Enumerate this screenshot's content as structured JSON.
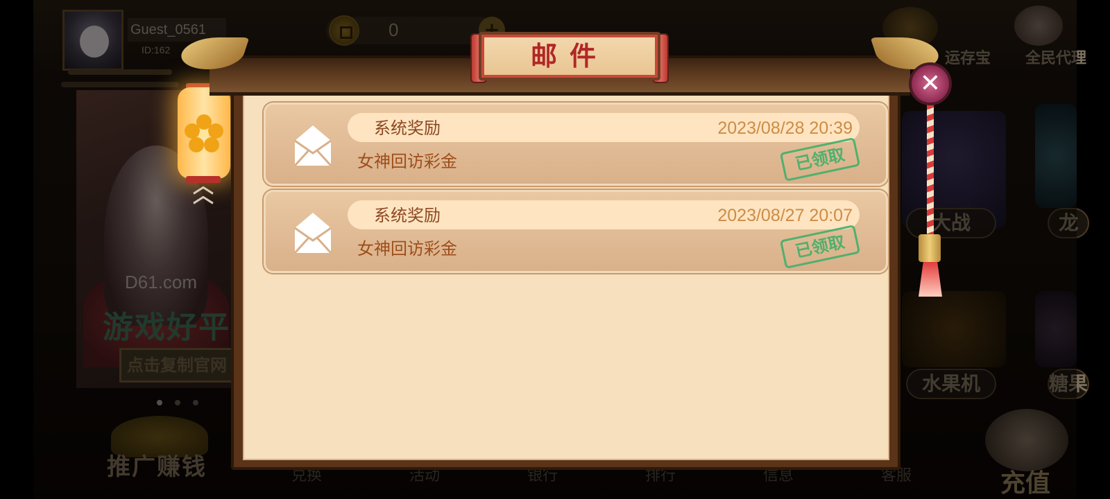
{
  "background": {
    "player": {
      "name": "Guest_0561",
      "id": "ID:162"
    },
    "coins": {
      "amount": "0"
    },
    "poster": {
      "site": "D61.com",
      "slogan": "游戏好平",
      "copy_button": "点击复制官网"
    },
    "promo_label": "推广赚钱",
    "bottom_nav": [
      "兑换",
      "活动",
      "银行",
      "排行",
      "信息",
      "客服"
    ],
    "top_right": [
      "运存宝",
      "全民代理"
    ],
    "right_games": [
      "大战",
      "龙",
      "水果机",
      "糖果"
    ],
    "recharge_label": "充值"
  },
  "dialog": {
    "title": "邮件",
    "close_symbol": "✕",
    "mails": [
      {
        "sender": "系统奖励",
        "time": "2023/08/28 20:39",
        "subject": "女神回访彩金",
        "status": "已领取"
      },
      {
        "sender": "系统奖励",
        "time": "2023/08/27 20:07",
        "subject": "女神回访彩金",
        "status": "已领取"
      }
    ]
  },
  "icons": {
    "envelope": "envelope-icon",
    "close": "close-icon",
    "lantern_flower": "flower-icon",
    "chevrons": "chevron-up-icon"
  },
  "colors": {
    "panel_bg": "#f6e0be",
    "title_red": "#b12726",
    "stamp_green": "#40b06a",
    "time_orange": "#cc8c46",
    "frame_brown": "#5a3318"
  }
}
